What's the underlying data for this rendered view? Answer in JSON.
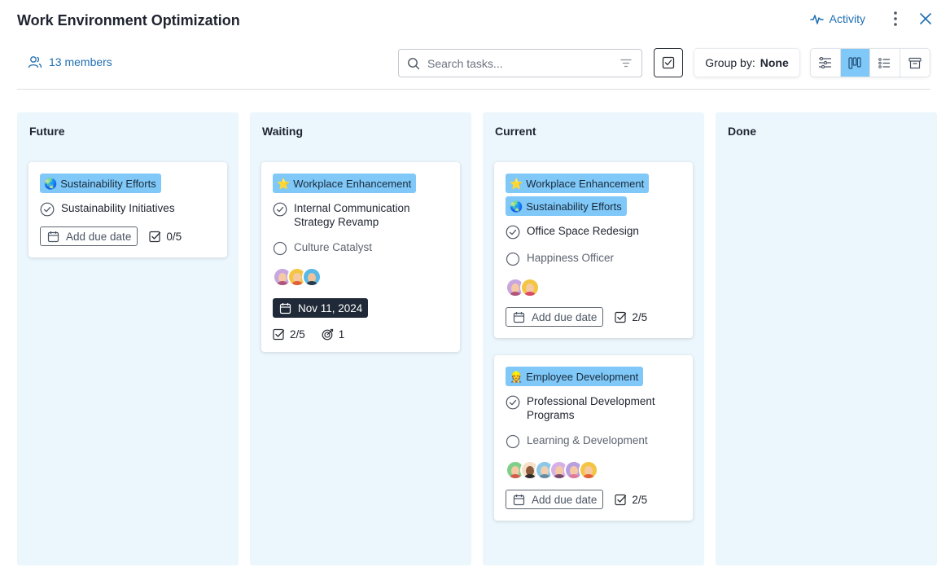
{
  "header": {
    "title": "Work Environment Optimization",
    "activity_label": "Activity",
    "members_label": "13 members"
  },
  "toolbar": {
    "search_placeholder": "Search tasks...",
    "group_by_label": "Group by:",
    "group_by_value": "None",
    "views": [
      "filter-settings",
      "board",
      "list",
      "archive"
    ],
    "active_view": "board"
  },
  "colors": {
    "accent": "#1f6fb3",
    "column_bg": "#ebf6fd",
    "tag_bg": "#7fc8f8",
    "date_chip_bg": "#1f2937"
  },
  "columns": [
    {
      "title": "Future",
      "cards": [
        {
          "tags": [
            {
              "icon": "globe-icon",
              "label": "Sustainability Efforts"
            }
          ],
          "tasks": [
            {
              "label": "Sustainability Initiatives",
              "done": true
            }
          ],
          "due_label": "Add due date",
          "checklist": "0/5"
        }
      ]
    },
    {
      "title": "Waiting",
      "cards": [
        {
          "tags": [
            {
              "icon": "star-icon",
              "label": "Workplace Enhancement"
            }
          ],
          "tasks": [
            {
              "label": "Internal Communication Strategy Revamp",
              "done": true
            },
            {
              "label": "Culture Catalyst",
              "done": false
            }
          ],
          "assignee_count": 3,
          "due_date": "Nov 11, 2024",
          "checklist": "2/5",
          "goals": "1"
        }
      ]
    },
    {
      "title": "Current",
      "cards": [
        {
          "tags": [
            {
              "icon": "star-icon",
              "label": "Workplace Enhancement"
            },
            {
              "icon": "globe-icon",
              "label": "Sustainability Efforts"
            }
          ],
          "tasks": [
            {
              "label": "Office Space Redesign",
              "done": true
            },
            {
              "label": "Happiness Officer",
              "done": false
            }
          ],
          "assignee_count": 2,
          "due_label": "Add due date",
          "checklist": "2/5"
        },
        {
          "tags": [
            {
              "icon": "worker-icon",
              "label": "Employee Development"
            }
          ],
          "tasks": [
            {
              "label": "Professional Development Programs",
              "done": true
            },
            {
              "label": "Learning & Development",
              "done": false
            }
          ],
          "assignee_count": 6,
          "due_label": "Add due date",
          "checklist": "2/5"
        }
      ]
    },
    {
      "title": "Done",
      "cards": []
    }
  ]
}
